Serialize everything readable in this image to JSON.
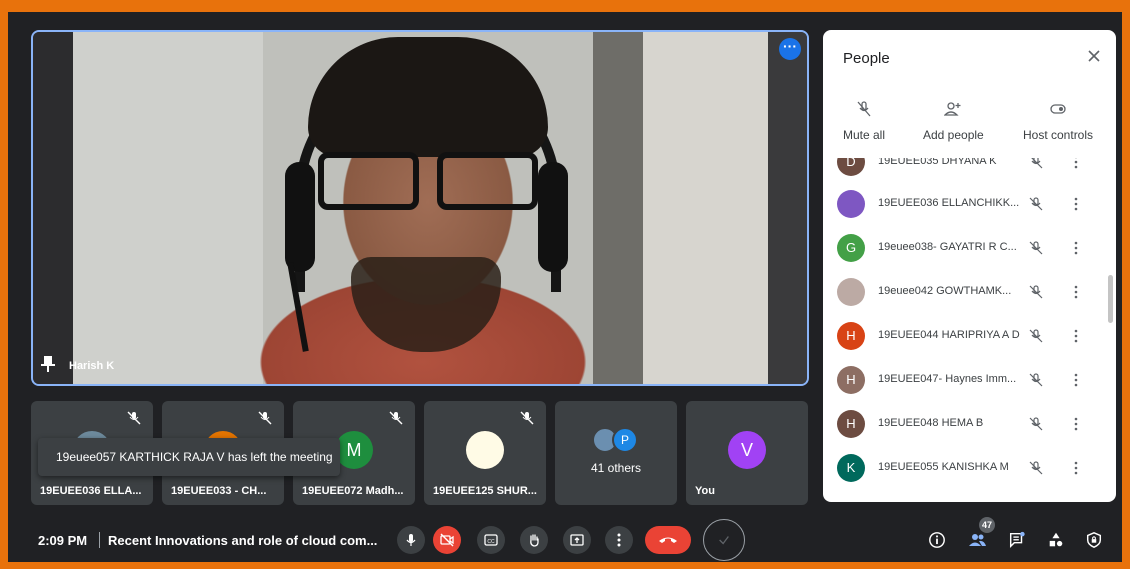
{
  "main_video": {
    "speaker_name": "Harish K"
  },
  "thumbnails": [
    {
      "name": "19EUEE036 ELLA...",
      "avatar_letter": "",
      "avatar_color": "#3c4043"
    },
    {
      "name": "19EUEE033 - CH...",
      "avatar_letter": "",
      "avatar_color": "#e37400"
    },
    {
      "name": "19EUEE072 Madh...",
      "avatar_letter": "M",
      "avatar_color": "#1e8e3e"
    },
    {
      "name": "19EUEE125 SHUR...",
      "avatar_letter": "",
      "avatar_color": "#fffbe6"
    },
    {
      "name": "",
      "others_count": "41 others",
      "avatar_letter": "P",
      "avatar_color": "#1e88e5"
    },
    {
      "name": "You",
      "avatar_letter": "V",
      "avatar_color": "#a142f4"
    }
  ],
  "toast": {
    "message": "19euee057 KARTHICK RAJA V has left the meeting"
  },
  "bottom_bar": {
    "time": "2:09 PM",
    "meeting_title": "Recent Innovations and role of cloud com...",
    "people_count": "47"
  },
  "people_panel": {
    "title": "People",
    "actions": [
      {
        "label": "Mute all",
        "icon": "mute-all-icon"
      },
      {
        "label": "Add people",
        "icon": "add-person-icon"
      },
      {
        "label": "Host controls",
        "icon": "toggle-icon"
      }
    ],
    "participants": [
      {
        "name": "19EUEE035 DHYANA K",
        "letter": "D",
        "color": "#6d4c41"
      },
      {
        "name": "19EUEE036 ELLANCHIKK...",
        "letter": "",
        "color": "#7e57c2"
      },
      {
        "name": "19euee038- GAYATRI R C...",
        "letter": "G",
        "color": "#43a047"
      },
      {
        "name": "19euee042 GOWTHAMK...",
        "letter": "",
        "color": "#bcaaa4"
      },
      {
        "name": "19EUEE044 HARIPRIYA A D",
        "letter": "H",
        "color": "#d84315"
      },
      {
        "name": "19EUEE047- Haynes Imm...",
        "letter": "H",
        "color": "#8d6e63"
      },
      {
        "name": "19EUEE048 HEMA B",
        "letter": "H",
        "color": "#6d4c41"
      },
      {
        "name": "19EUEE055 KANISHKA M",
        "letter": "K",
        "color": "#00695c"
      }
    ]
  }
}
